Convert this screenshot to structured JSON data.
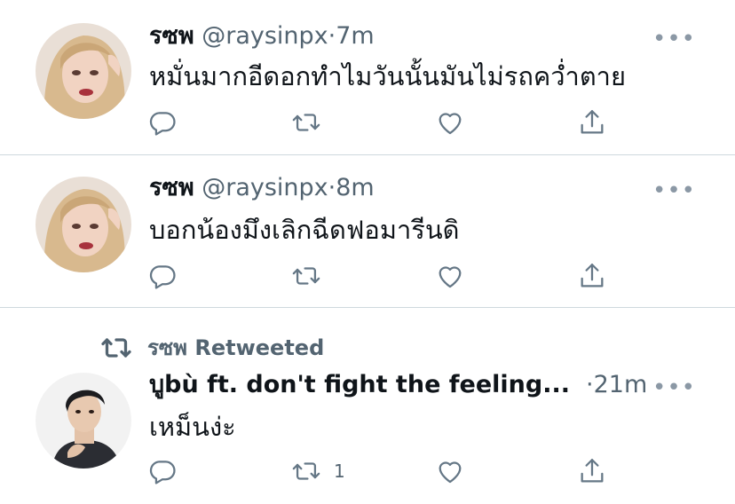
{
  "tweets": [
    {
      "author_name": "รซพ",
      "handle": "@raysinpx",
      "separator": "·",
      "time": "7m",
      "text": "หมั่นมากอีดอกทำไมวันนั้นมันไม่รถคว่ำตาย",
      "more": "•••",
      "reply_count": "",
      "retweet_count": "",
      "like_count": ""
    },
    {
      "author_name": "รซพ",
      "handle": "@raysinpx",
      "separator": "·",
      "time": "8m",
      "text": "บอกน้องมึงเลิกฉีดฟอมารีนดิ",
      "more": "•••",
      "reply_count": "",
      "retweet_count": "",
      "like_count": ""
    },
    {
      "retweeted_by": "รซพ Retweeted",
      "author_name": "บูbù ft. don't fight the feeling...",
      "separator": "·",
      "time": "21m",
      "text": "เหม็นง่ะ",
      "more": "•••",
      "reply_count": "",
      "retweet_count": "1",
      "like_count": ""
    }
  ],
  "icons": {
    "reply": "reply-icon",
    "retweet": "retweet-icon",
    "like": "heart-icon",
    "share": "share-icon",
    "more": "more-icon"
  },
  "colors": {
    "text": "#0f1419",
    "secondary": "#536471",
    "divider": "#cfd9de",
    "icon": "#657786"
  }
}
